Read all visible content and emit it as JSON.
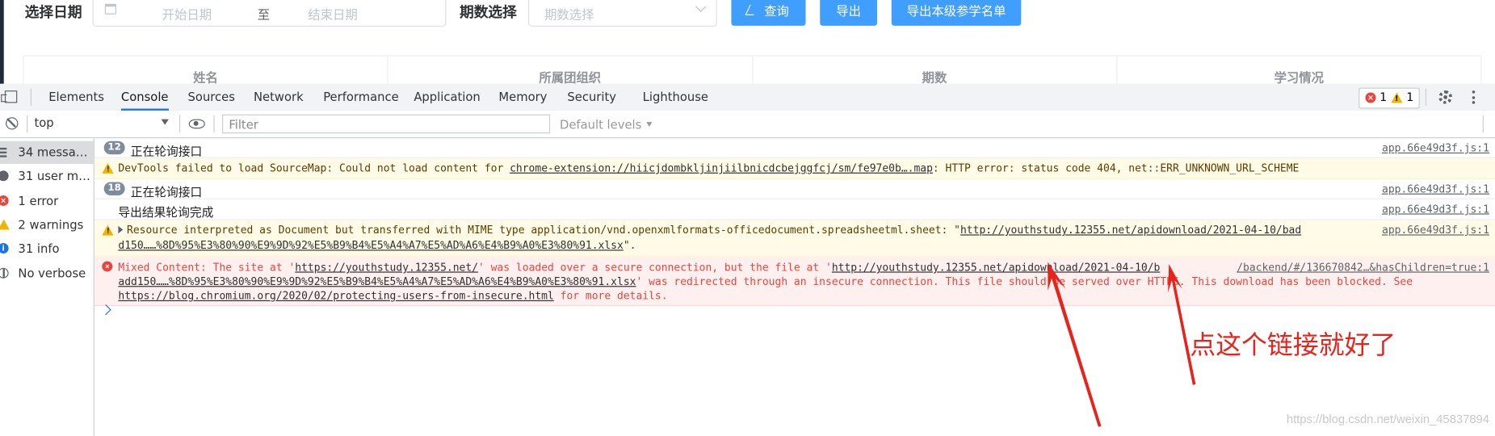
{
  "page": {
    "date_label": "选择日期",
    "start_date_placeholder": "开始日期",
    "range_separator": "至",
    "end_date_placeholder": "结束日期",
    "period_label": "期数选择",
    "period_placeholder": "期数选择",
    "query_button": "查询",
    "export_button": "导出",
    "export_roster_button": "导出本级参学名单",
    "table_headers": [
      "姓名",
      "所属团组织",
      "期数",
      "学习情况"
    ],
    "accent_color": "#409eff"
  },
  "devtools": {
    "tabs": [
      "Elements",
      "Console",
      "Sources",
      "Network",
      "Performance",
      "Application",
      "Memory",
      "Security",
      "Lighthouse"
    ],
    "active_tab": "Console",
    "error_count": "1",
    "warning_count": "1",
    "context": "top",
    "filter_placeholder": "Filter",
    "levels_label": "Default levels",
    "sidebar": [
      {
        "label": "34 messages",
        "icon": "list-icon"
      },
      {
        "label": "31 user mes…",
        "icon": "user-icon"
      },
      {
        "label": "1 error",
        "icon": "error-icon"
      },
      {
        "label": "2 warnings",
        "icon": "warning-icon"
      },
      {
        "label": "31 info",
        "icon": "info-icon"
      },
      {
        "label": "No verbose",
        "icon": "verbose-icon"
      }
    ],
    "messages": {
      "m1": {
        "count": "12",
        "text": "正在轮询接口",
        "source": "app.66e49d3f.js:1"
      },
      "m2": {
        "prefix": "DevTools failed to load SourceMap: Could not load content for ",
        "link": "chrome-extension://hiicjdombkljinjiilbnicdcbejggfcj/sm/fe97e0b….map",
        "suffix": ": HTTP error: status code 404, net::ERR_UNKNOWN_URL_SCHEME"
      },
      "m3": {
        "count": "18",
        "text": "正在轮询接口",
        "source": "app.66e49d3f.js:1"
      },
      "m4": {
        "text": "导出结果轮询完成",
        "source": "app.66e49d3f.js:1"
      },
      "m5": {
        "line1_prefix": "Resource interpreted as Document but transferred with MIME type application/vnd.openxmlformats-officedocument.spreadsheetml.sheet: \"",
        "line1_link": "http://youthstudy.12355.net/apidownload/2021-04-10/bad",
        "line2_link": "d150……%8D%95%E3%80%90%E9%9D%92%E5%B9%B4%E5%A4%A7%E5%AD%A6%E4%B9%A0%E3%80%91.xlsx",
        "line2_suffix": "\".",
        "source": "app.66e49d3f.js:1"
      },
      "m6": {
        "l1_a": "Mixed Content: The site at '",
        "l1_link1": "https://youthstudy.12355.net/",
        "l1_b": "' was loaded over a secure connection, but the file at '",
        "l1_link2": "http://youthstudy.12355.net/apidownload/2021-04-10/b",
        "l1_src": "/backend/#/136670842…&hasChildren=true:1",
        "l2_link": "add150……%8D%95%E3%80%90%E9%9D%92%E5%B9%B4%E5%A4%A7%E5%AD%A6%E4%B9%A0%E3%80%91.xlsx",
        "l2_text": "' was redirected through an insecure connection. This file should be served over HTTPS. This download has been blocked. See",
        "l3_link": "https://blog.chromium.org/2020/02/protecting-users-from-insecure.html",
        "l3_text": " for more details."
      }
    }
  },
  "annotation": {
    "text": "点这个链接就好了",
    "color": "#e8231c"
  },
  "watermark": "https://blog.csdn.net/weixin_45837894"
}
